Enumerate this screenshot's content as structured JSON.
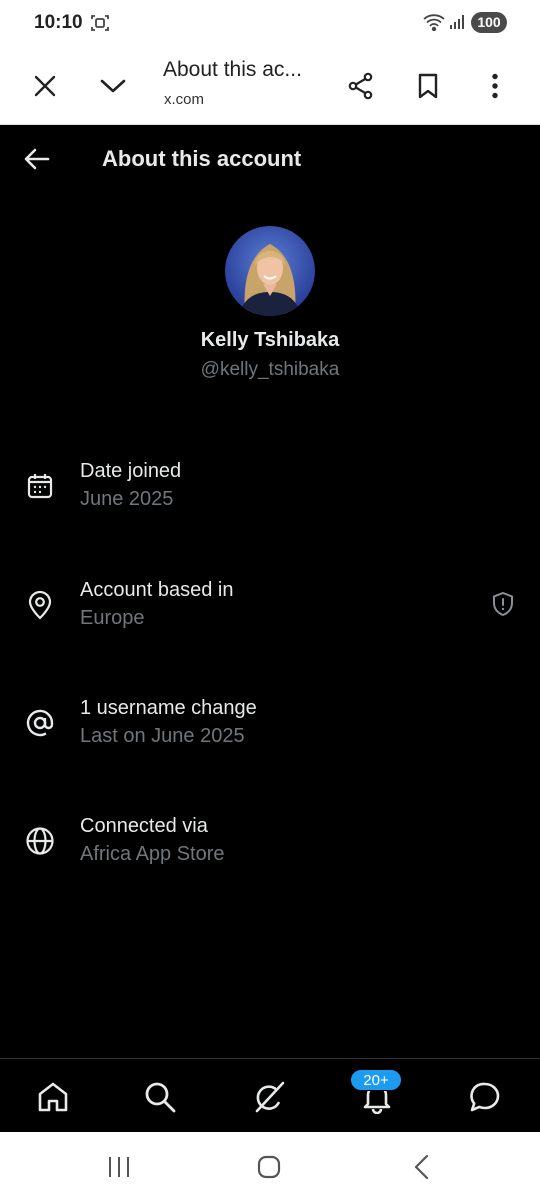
{
  "status_bar": {
    "time": "10:10",
    "battery": "100"
  },
  "browser": {
    "title": "About this ac...",
    "domain": "x.com"
  },
  "header": {
    "title": "About this account"
  },
  "profile": {
    "name": "Kelly Tshibaka",
    "handle": "@kelly_tshibaka"
  },
  "info_items": [
    {
      "icon": "calendar-icon",
      "label": "Date joined",
      "value": "June 2025"
    },
    {
      "icon": "location-pin-icon",
      "label": "Account based in",
      "value": "Europe"
    },
    {
      "icon": "at-sign-icon",
      "label": "1 username change",
      "value": "Last on June 2025"
    },
    {
      "icon": "globe-icon",
      "label": "Connected via",
      "value": "Africa App Store"
    }
  ],
  "bottom_nav": {
    "notification_badge": "20+"
  },
  "colors": {
    "background": "#000000",
    "primary_text": "#e7e9ea",
    "secondary_text": "#71767b",
    "accent": "#1d9bf0"
  }
}
